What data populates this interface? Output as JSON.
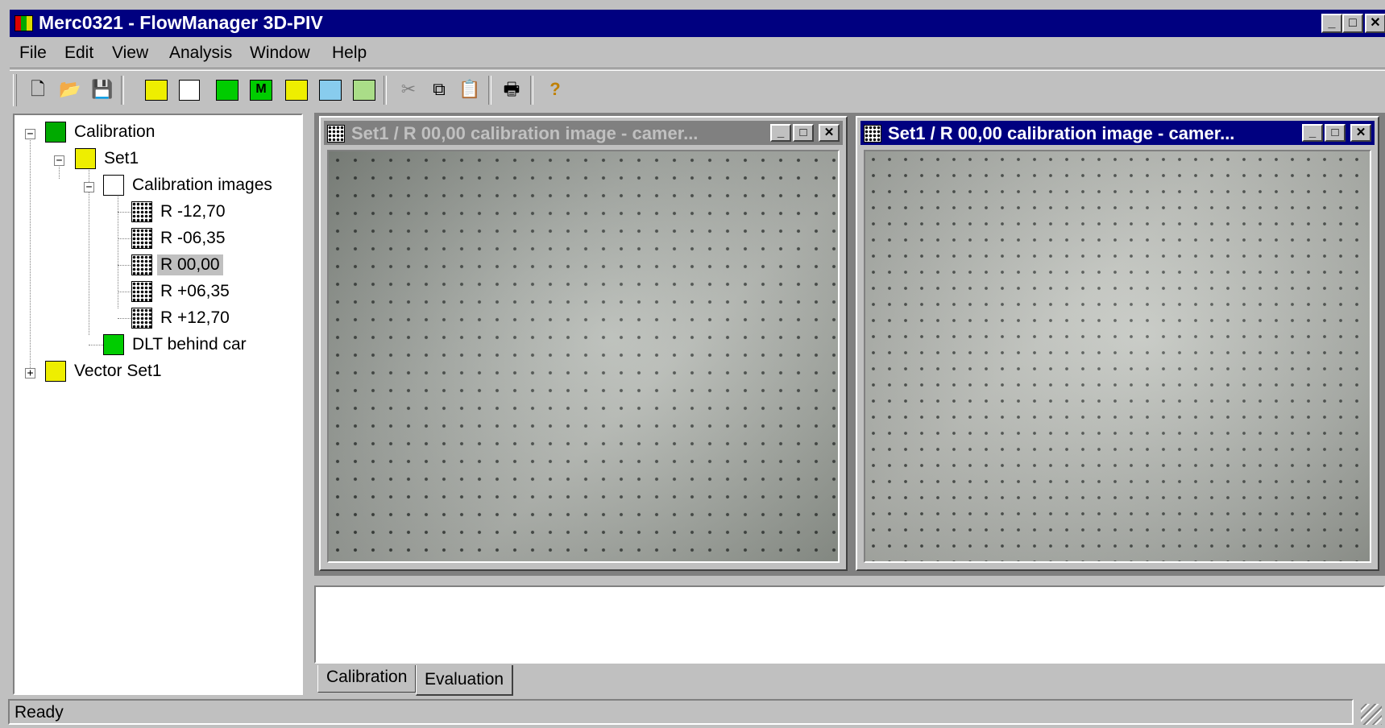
{
  "window": {
    "title": "Merc0321 - FlowManager 3D-PIV",
    "caption_buttons": {
      "minimize": "_",
      "maximize": "□",
      "close": "✕"
    }
  },
  "menu": [
    {
      "label": "File"
    },
    {
      "label": "Edit"
    },
    {
      "label": "View"
    },
    {
      "label": "Analysis"
    },
    {
      "label": "Window"
    },
    {
      "label": "Help"
    }
  ],
  "toolbar": {
    "icons": [
      "new-file-icon",
      "open-folder-icon",
      "save-disk-icon",
      "calibration-setup-icon",
      "image-stack-icon",
      "dlt-icon",
      "model-m-icon",
      "vector-set-icon",
      "multi-stack-icon",
      "3d-stack-icon",
      "cut-icon",
      "copy-icon",
      "paste-icon",
      "print-icon",
      "help-question-icon"
    ]
  },
  "tree": {
    "calibration": "Calibration",
    "set1": "Set1",
    "calibration_images": "Calibration images",
    "images": [
      "R -12,70",
      "R -06,35",
      "R 00,00",
      "R +06,35",
      "R +12,70"
    ],
    "selected_image": "R 00,00",
    "dlt": "DLT behind car",
    "vector_set": "Vector Set1"
  },
  "child_windows": [
    {
      "title": "Set1 / R 00,00 calibration image - camer...",
      "active": false
    },
    {
      "title": "Set1 / R 00,00 calibration image - camer...",
      "active": true
    }
  ],
  "tabs": [
    {
      "label": "Calibration",
      "active": false
    },
    {
      "label": "Evaluation",
      "active": true
    }
  ],
  "status": {
    "text": "Ready"
  },
  "colors": {
    "titlebar_active": "#000080",
    "titlebar_inactive": "#808080",
    "face": "#c0c0c0"
  }
}
